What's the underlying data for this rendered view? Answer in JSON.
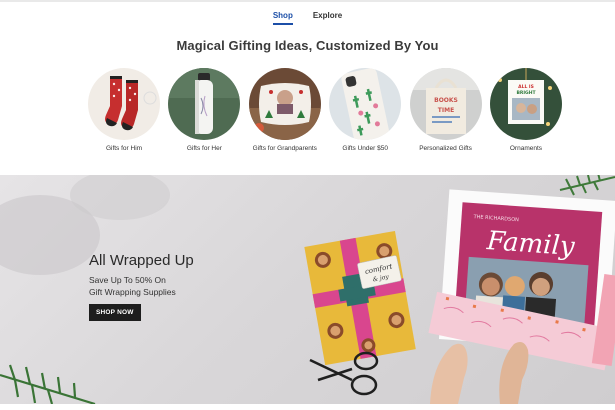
{
  "tabs": [
    {
      "label": "Shop",
      "active": true
    },
    {
      "label": "Explore",
      "active": false
    }
  ],
  "headline": "Magical Gifting Ideas, Customized By You",
  "categories": [
    {
      "label": "Gifts for Him",
      "image": "red patterned socks"
    },
    {
      "label": "Gifts for Her",
      "image": "white water bottle"
    },
    {
      "label": "Gifts for Grandparents",
      "image": "photo pillow"
    },
    {
      "label": "Gifts Under $50",
      "image": "cactus phone case"
    },
    {
      "label": "Personalized Gifts",
      "image": "books tote bag"
    },
    {
      "label": "Ornaments",
      "image": "photo ornament"
    }
  ],
  "thumb_texts": {
    "tote_line1": "BOOKS",
    "tote_line2": "TIME",
    "ornament_line1": "ALL IS",
    "ornament_line2": "BRIGHT"
  },
  "hero": {
    "title": "All Wrapped Up",
    "subtitle_line1": "Save Up To 50% On",
    "subtitle_line2": "Gift Wrapping Supplies",
    "button_label": "SHOP NOW",
    "tag_line1": "comfort",
    "tag_line2": "& joy",
    "card_caption": "THE RICHARDSON",
    "card_title": "Family"
  },
  "colors": {
    "accent": "#1c4fa8",
    "button_bg": "#1d1d1d",
    "card_magenta": "#b8336a",
    "wrap_yellow": "#e8b93a",
    "ribbon_pink": "#d9468e"
  }
}
